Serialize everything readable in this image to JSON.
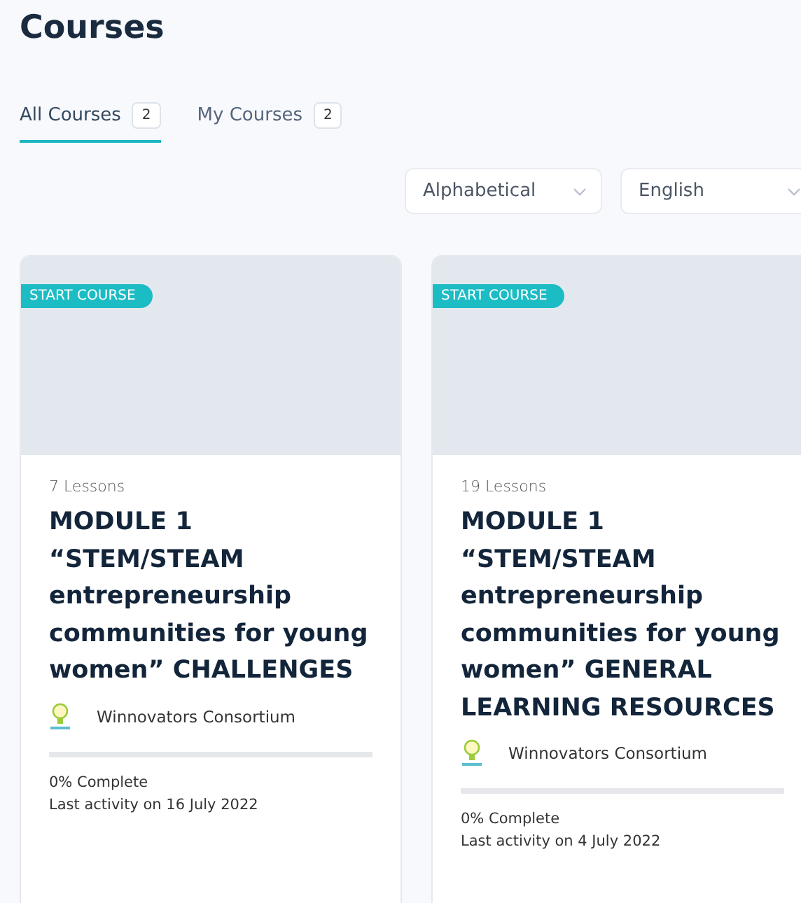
{
  "page_title": "Courses",
  "tabs": [
    {
      "label": "All Courses",
      "count": "2",
      "selected": true
    },
    {
      "label": "My Courses",
      "count": "2",
      "selected": false
    }
  ],
  "filters": [
    {
      "value": "Alphabetical"
    },
    {
      "value": "English"
    }
  ],
  "courses": [
    {
      "badge": "START COURSE",
      "lessons": "7 Lessons",
      "title": "MODULE 1 “STEM/STEAM entrepreneurship communities for young women” CHALLENGES",
      "author": "Winnovators Consortium",
      "level": 0,
      "progress": "0% Complete",
      "last_activity": "Last activity on 16 July 2022"
    },
    {
      "badge": "START COURSE",
      "lessons": "19 Lessons",
      "title": "MODULE 1 “STEM/STEAM entrepreneurship communities for young women” GENERAL LEARNING RESOURCES",
      "author": "Winnovators Consortium",
      "level": 0,
      "progress": "0% Complete",
      "last_activity": "Last activity on 4 July 2022"
    }
  ]
}
